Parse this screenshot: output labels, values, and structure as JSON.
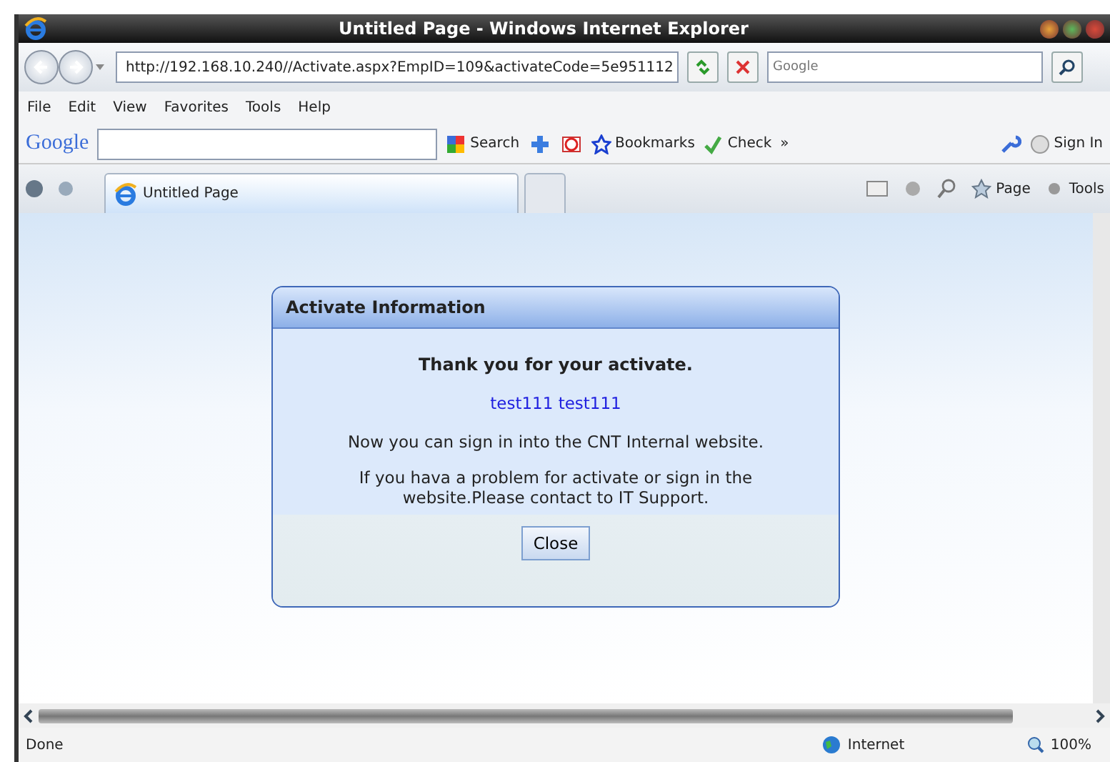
{
  "window": {
    "title": "Untitled Page - Windows Internet Explorer"
  },
  "address_bar": {
    "url": "http://192.168.10.240//Activate.aspx?EmpID=109&activateCode=5e951112",
    "search_placeholder": "Google"
  },
  "menu": [
    "File",
    "Edit",
    "View",
    "Favorites",
    "Tools",
    "Help"
  ],
  "google_toolbar": {
    "logo": "Google",
    "search": "Search",
    "bookmarks": "Bookmarks",
    "check": "Check",
    "more": "»",
    "sign_in": "Sign In"
  },
  "tabs": [
    {
      "label": "Untitled Page",
      "selected": true
    },
    {
      "selected": false
    }
  ],
  "command_bar": {
    "page": "Page",
    "tools": "Tools"
  },
  "dialog": {
    "title": "Activate Information",
    "heading": "Thank you for your activate.",
    "user": "test111 test111",
    "message": "Now you can sign in into the CNT Internal website.",
    "note": "If you hava a problem for activate or sign in the website.Please contact to IT Support.",
    "button": "Close"
  },
  "status_bar": {
    "text": "Done",
    "zone": "Internet",
    "zoom": "100%"
  }
}
